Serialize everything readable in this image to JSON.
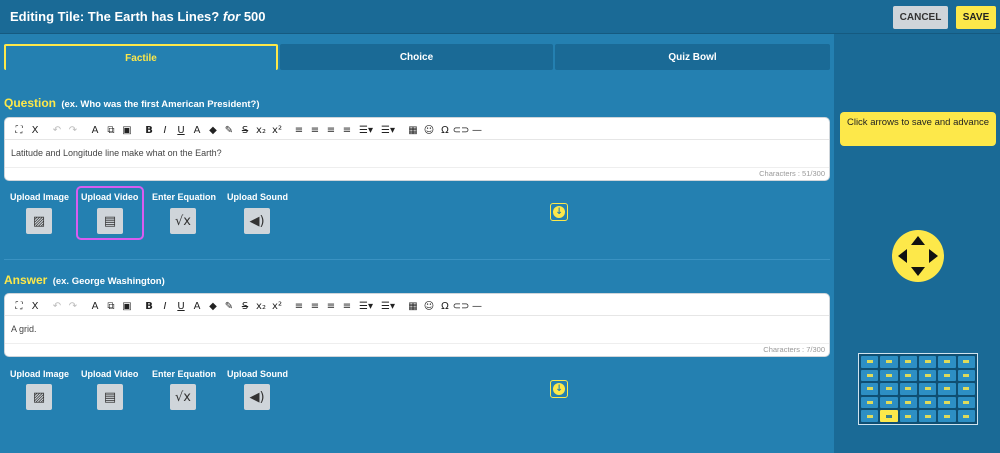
{
  "header": {
    "title_prefix": "Editing Tile: The Earth has Lines?",
    "title_for": "for",
    "title_points": "500",
    "cancel_label": "CANCEL",
    "save_label": "SAVE"
  },
  "tabs": [
    {
      "label": "Factile",
      "active": true
    },
    {
      "label": "Choice",
      "active": false
    },
    {
      "label": "Quiz Bowl",
      "active": false
    }
  ],
  "question": {
    "label": "Question",
    "example": "(ex. Who was the first American President?)",
    "text": "Latitude and Longitude line make what on the Earth?",
    "char_count": "Characters : 51/300"
  },
  "answer": {
    "label": "Answer",
    "example": "(ex. George Washington)",
    "text": "A grid.",
    "char_count": "Characters : 7/300"
  },
  "uploads": {
    "image": "Upload Image",
    "video": "Upload Video",
    "equation": "Enter Equation",
    "sound": "Upload Sound"
  },
  "sidebar": {
    "hint": "Click arrows to save and advance"
  },
  "colors": {
    "accent": "#fde84a",
    "background": "#2480b1",
    "panel": "#1a6a96",
    "highlight": "#d85cf0"
  }
}
